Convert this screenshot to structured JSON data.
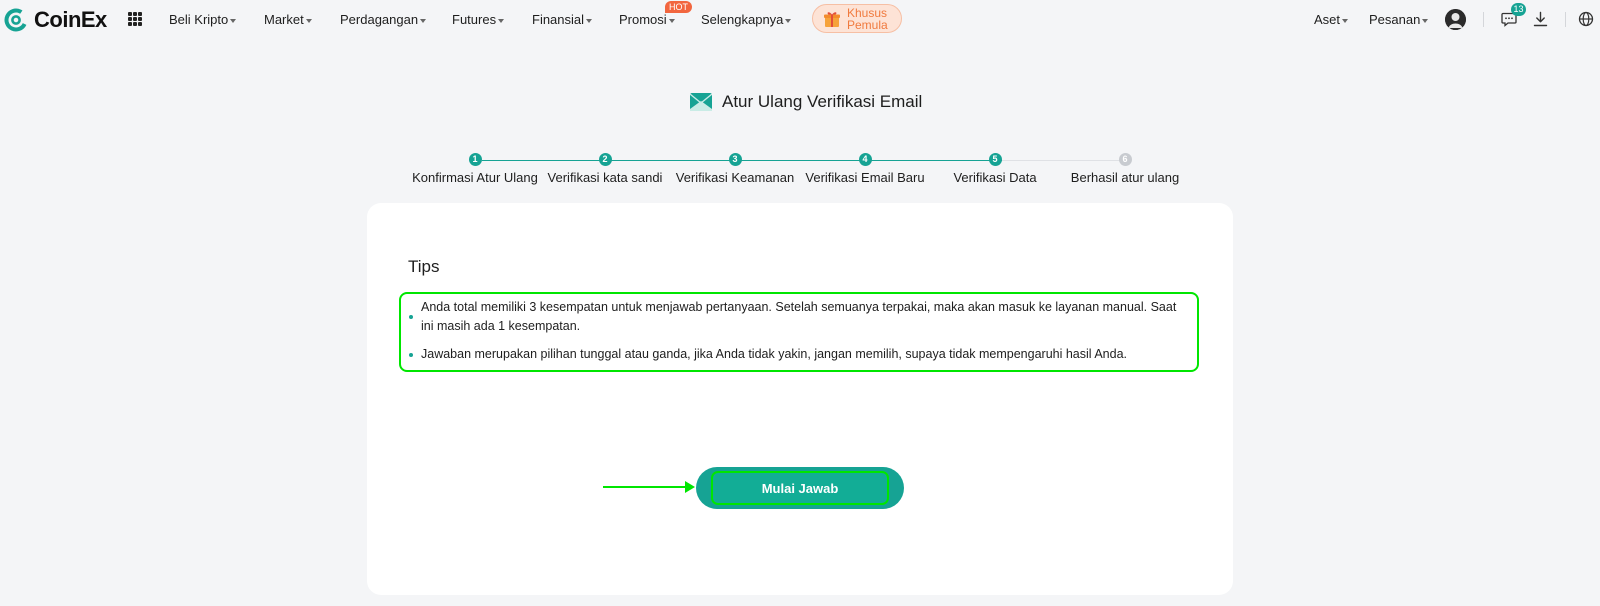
{
  "brand": {
    "name": "CoinEx",
    "accent": "#16a394"
  },
  "nav": {
    "items": [
      {
        "label": "Beli Kripto"
      },
      {
        "label": "Market"
      },
      {
        "label": "Perdagangan"
      },
      {
        "label": "Futures"
      },
      {
        "label": "Finansial"
      },
      {
        "label": "Promosi"
      },
      {
        "label": "Selengkapnya"
      }
    ],
    "hot_badge": "HOT",
    "promo_line1": "Khusus",
    "promo_line2": "Pemula",
    "assets_label": "Aset",
    "orders_label": "Pesanan",
    "message_count": "13"
  },
  "page": {
    "title": "Atur Ulang Verifikasi Email",
    "steps": [
      {
        "num": "1",
        "label": "Konfirmasi Atur Ulang",
        "state": "active"
      },
      {
        "num": "2",
        "label": "Verifikasi kata sandi",
        "state": "active"
      },
      {
        "num": "3",
        "label": "Verifikasi Keamanan",
        "state": "active"
      },
      {
        "num": "4",
        "label": "Verifikasi Email Baru",
        "state": "active"
      },
      {
        "num": "5",
        "label": "Verifikasi Data",
        "state": "active"
      },
      {
        "num": "6",
        "label": "Berhasil atur ulang",
        "state": "pending"
      }
    ]
  },
  "tips": {
    "title": "Tips",
    "items": [
      "Anda total memiliki 3 kesempatan untuk menjawab pertanyaan. Setelah semuanya terpakai, maka akan masuk ke layanan manual. Saat ini masih ada 1 kesempatan.",
      "Jawaban merupakan pilihan tunggal atau ganda, jika Anda tidak yakin, jangan memilih, supaya tidak mempengaruhi hasil Anda."
    ]
  },
  "actions": {
    "start_label": "Mulai Jawab"
  }
}
